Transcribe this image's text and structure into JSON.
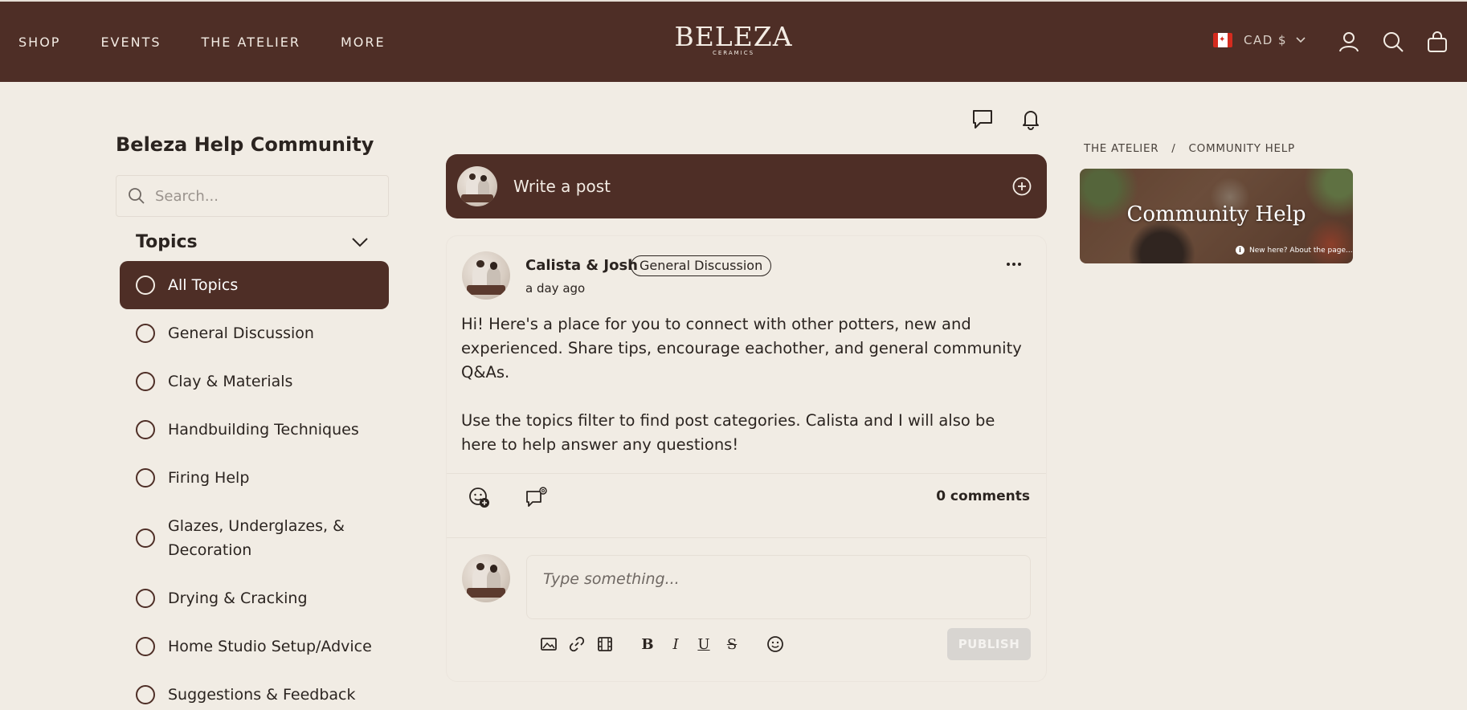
{
  "header": {
    "nav": [
      "SHOP",
      "EVENTS",
      "THE ATELIER",
      "MORE"
    ],
    "logo_main": "BELEZA",
    "logo_sub": "CERAMICS",
    "currency": "CAD $",
    "icons": [
      "account-icon",
      "search-icon",
      "cart-icon"
    ],
    "bg_color": "#4e2e26"
  },
  "sidebar": {
    "title": "Beleza Help Community",
    "search_placeholder": "Search...",
    "topics_label": "Topics",
    "topics": [
      "All Topics",
      "General Discussion",
      "Clay & Materials",
      "Handbuilding Techniques",
      "Firing Help",
      "Glazes, Underglazes, & Decoration",
      "Drying & Cracking",
      "Home Studio Setup/Advice",
      "Suggestions & Feedback"
    ],
    "active_topic": "All Topics"
  },
  "feed": {
    "write_post_label": "Write a post",
    "post": {
      "author": "Calista & Josh",
      "tag": "General Discussion",
      "timestamp": "a day ago",
      "body": [
        "Hi! Here's a place for you to connect with other potters, new and experienced. Share tips, encourage eachother, and general community Q&As.",
        "Use the topics filter to find post categories. Calista and I will also be here to help answer any questions!"
      ],
      "comments": "0 comments",
      "comment_placeholder": "Type something...",
      "publish_label": "PUBLISH",
      "toolbar": [
        "image-icon",
        "link-icon",
        "video-icon",
        "bold-icon",
        "italic-icon",
        "underline-icon",
        "strikethrough-icon",
        "emoji-icon"
      ]
    }
  },
  "right": {
    "breadcrumb": [
      "THE ATELIER",
      "COMMUNITY HELP"
    ],
    "banner_title": "Community Help",
    "banner_note": "New here? About the page..."
  },
  "colors": {
    "brand": "#4e2e26",
    "background": "#f1ece4",
    "text": "#2b2420"
  }
}
